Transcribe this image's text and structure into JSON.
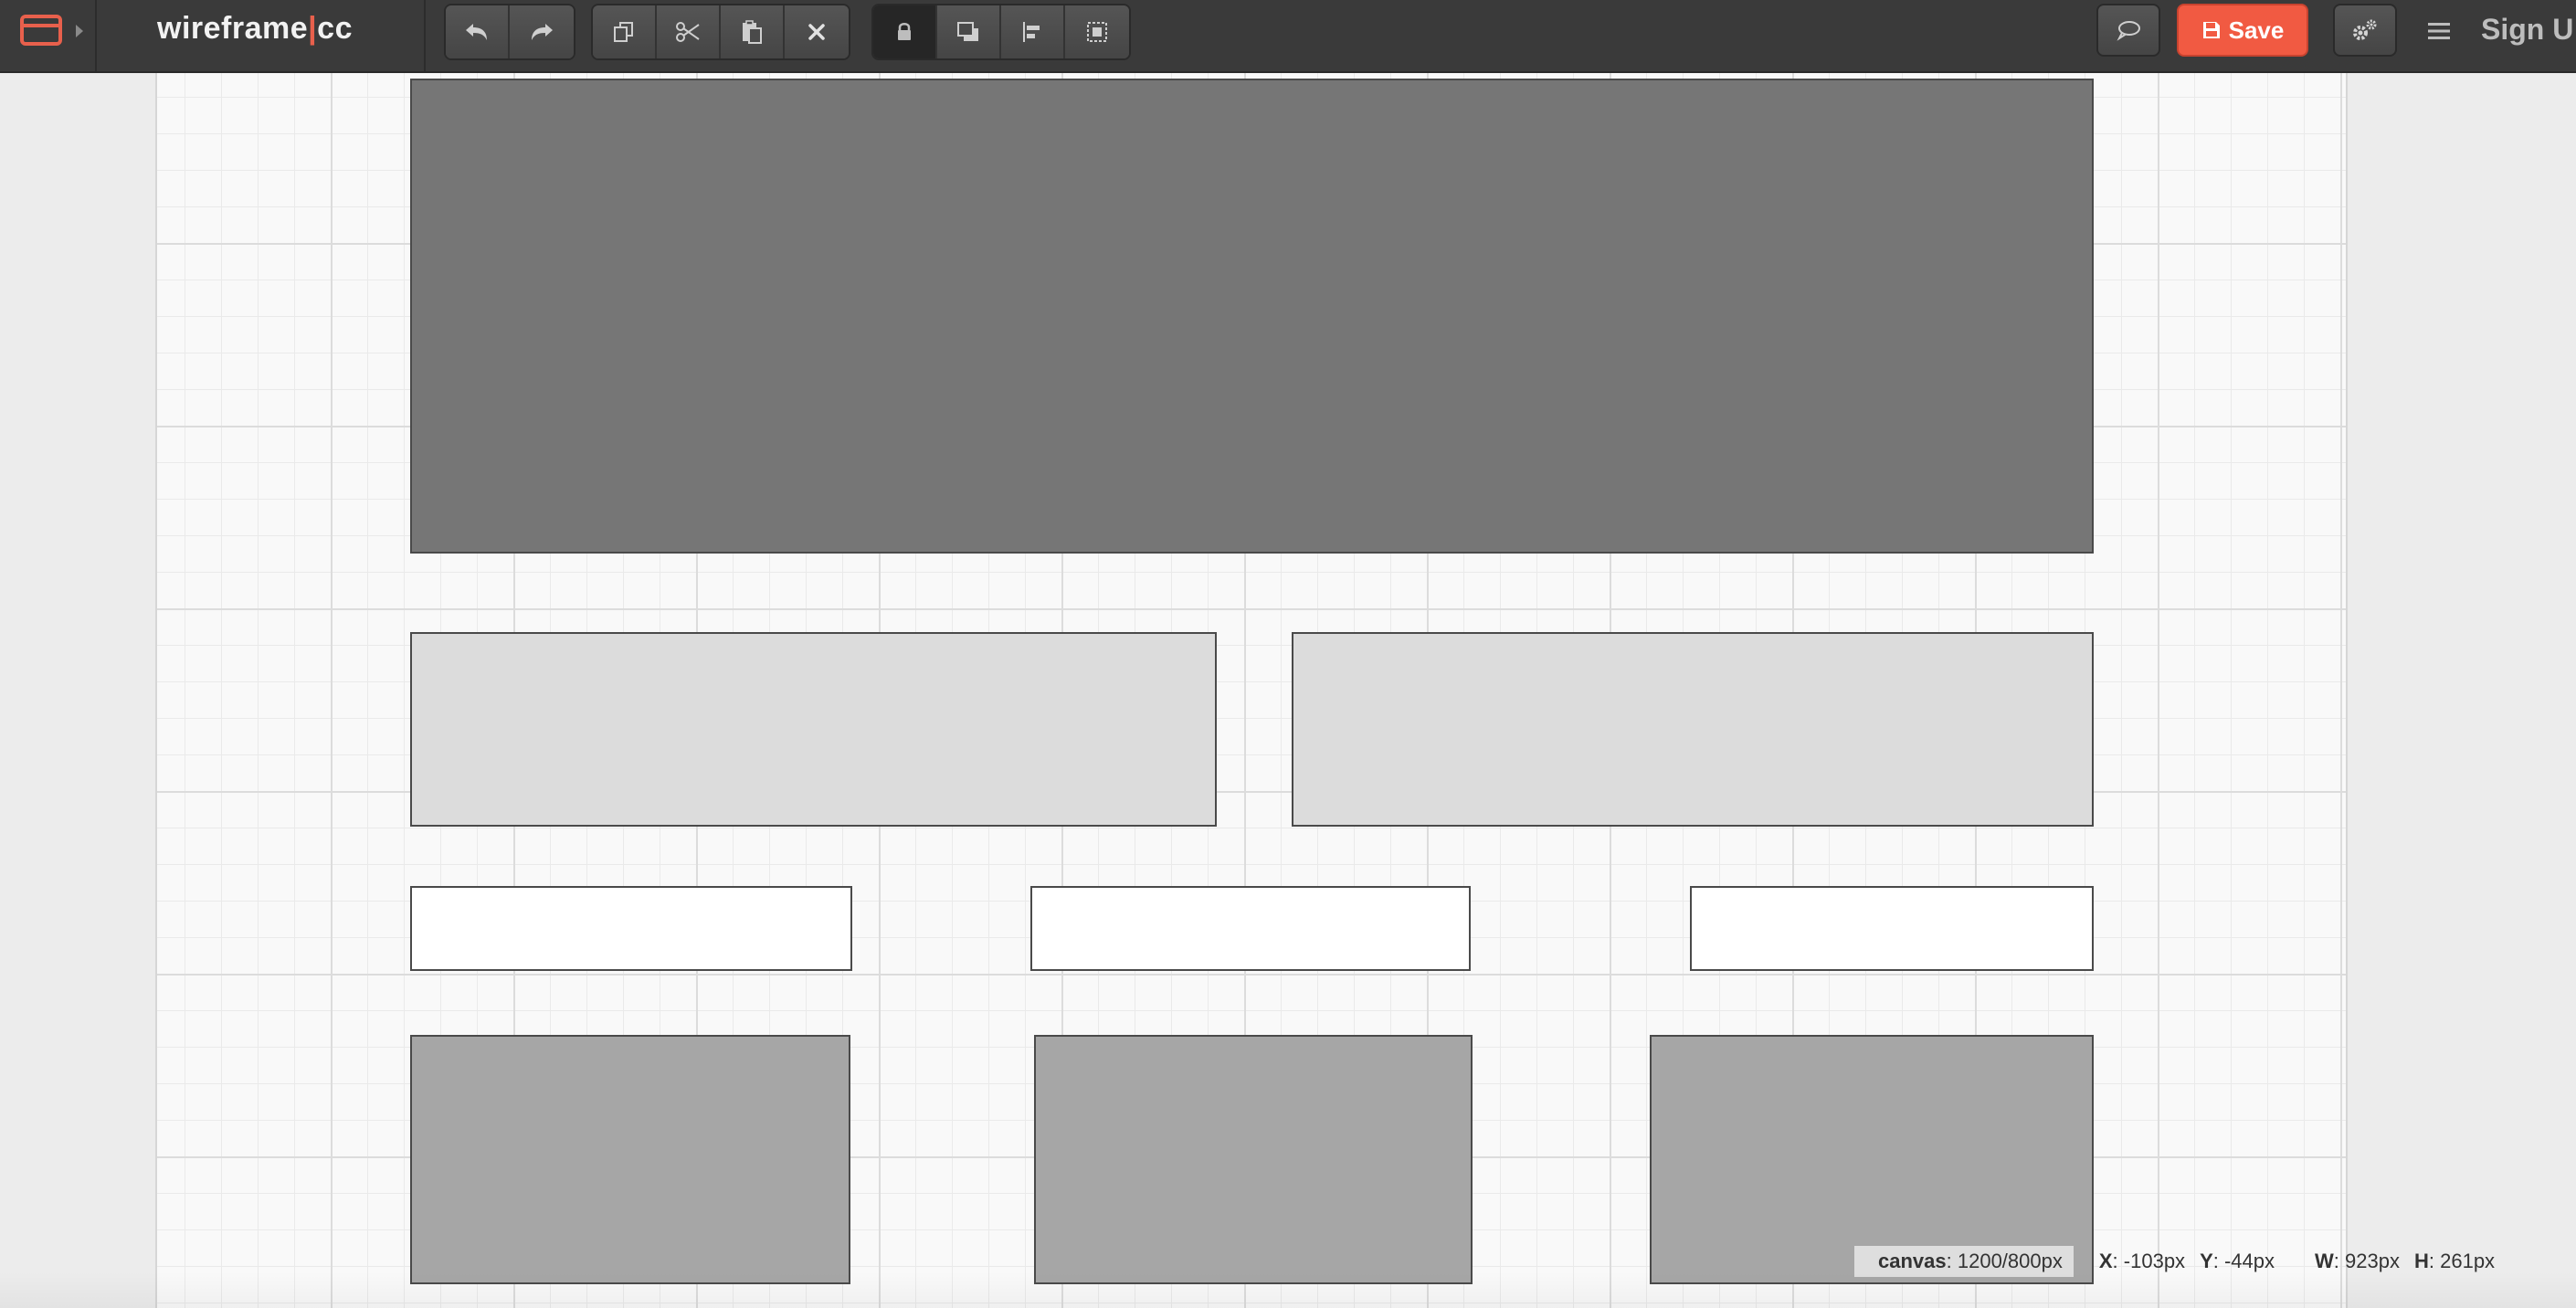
{
  "header": {
    "logo_left": "wireframe",
    "logo_sep": "|",
    "logo_right": "cc",
    "save_label": "Save",
    "signup_label": "Sign U"
  },
  "toolbar": {
    "history": [
      {
        "icon": "undo-icon"
      },
      {
        "icon": "redo-icon"
      }
    ],
    "clipboard": [
      {
        "icon": "copy-icon"
      },
      {
        "icon": "cut-icon"
      },
      {
        "icon": "paste-icon"
      },
      {
        "icon": "delete-icon"
      }
    ],
    "arrange": [
      {
        "icon": "lock-icon"
      },
      {
        "icon": "bring-front-icon"
      },
      {
        "icon": "align-left-icon"
      },
      {
        "icon": "group-icon"
      }
    ],
    "right": [
      {
        "icon": "comment-icon"
      },
      {
        "icon": "settings-icon"
      },
      {
        "icon": "hamburger-menu-icon"
      }
    ]
  },
  "colors": {
    "accent": "#f15a42",
    "toolbar_bg": "#3a3a3a",
    "hero_fill": "#767676",
    "light_fill": "#dcdcdc",
    "mid_fill": "#a6a6a6"
  },
  "status": {
    "canvas_label": "canvas",
    "canvas_value": "1200/800px",
    "x_label": "X",
    "x_value": "-103px",
    "y_label": "Y",
    "y_value": "-44px",
    "w_label": "W",
    "w_value": "923px",
    "h_label": "H",
    "h_value": "261px"
  }
}
